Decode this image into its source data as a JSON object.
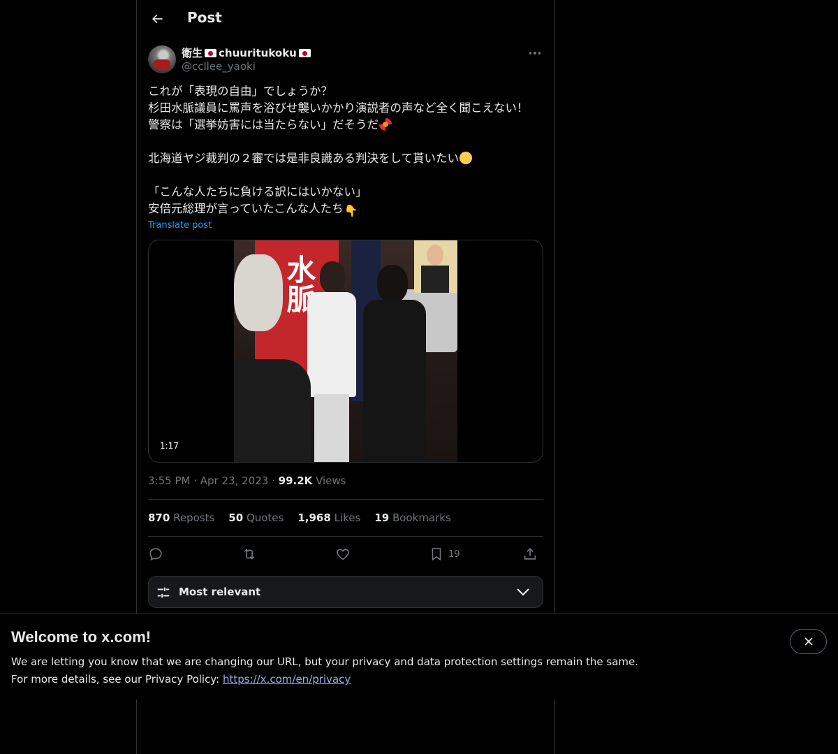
{
  "header": {
    "title": "Post"
  },
  "author": {
    "name_a": "衛生",
    "name_b": "chuuritukoku",
    "handle": "@ccllee_yaoki"
  },
  "tweet": {
    "lines": [
      "これが「表現の自由」でしょうか？",
      "杉田水脈議員に罵声を浴びせ襲いかかり演説者の声など全く聞こえない！",
      "警察は「選挙妨害には当たらない」だそうだ",
      "北海道ヤジ裁判の２審では是非良識ある判決をして貰いたい",
      "「こんな人たちに負ける訳にはいかない」",
      "安倍元総理が言っていたこんな人たち"
    ],
    "translate_label": "Translate post"
  },
  "media": {
    "duration": "1:17",
    "banner_text": "水脈"
  },
  "meta": {
    "time": "3:55 PM",
    "sep": "·",
    "date": "Apr 23, 2023",
    "views_count": "99.2K",
    "views_label": "Views"
  },
  "stats": {
    "reposts_count": "870",
    "reposts_label": "Reposts",
    "quotes_count": "50",
    "quotes_label": "Quotes",
    "likes_count": "1,968",
    "likes_label": "Likes",
    "bookmarks_count": "19",
    "bookmarks_label": "Bookmarks"
  },
  "actions": {
    "bookmark_count": "19"
  },
  "sort": {
    "label": "Most relevant"
  },
  "banner": {
    "title": "Welcome to x.com!",
    "line1": "We are letting you know that we are changing our URL, but your privacy and data protection settings remain the same.",
    "line2_prefix": "For more details, see our Privacy Policy: ",
    "link": "https://x.com/en/privacy"
  },
  "colors": {
    "accent": "#1d9bf0",
    "muted": "#71767b",
    "text": "#e7e9ea",
    "border": "#2f3336",
    "link_visited": "#a1a6e8"
  },
  "icons": [
    "back-arrow-icon",
    "more-icon",
    "reply-icon",
    "repost-icon",
    "like-icon",
    "bookmark-icon",
    "share-icon",
    "sliders-icon",
    "chevron-down-icon",
    "close-icon"
  ]
}
